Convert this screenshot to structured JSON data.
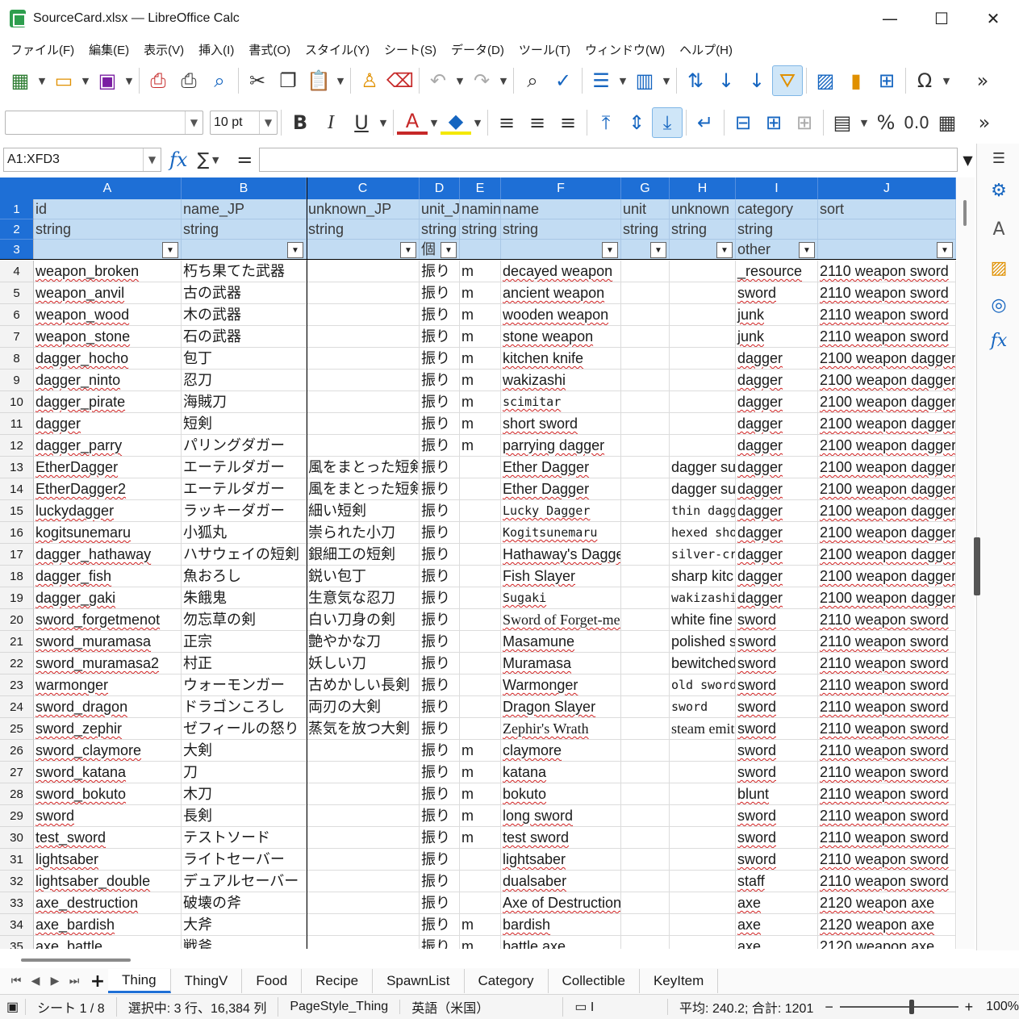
{
  "window": {
    "title": "SourceCard.xlsx — LibreOffice Calc",
    "minimize": "—",
    "maximize": "☐",
    "close": "✕"
  },
  "menu": [
    "ファイル(F)",
    "編集(E)",
    "表示(V)",
    "挿入(I)",
    "書式(O)",
    "スタイル(Y)",
    "シート(S)",
    "データ(D)",
    "ツール(T)",
    "ウィンドウ(W)",
    "ヘルプ(H)"
  ],
  "toolbar": {
    "font_name": "",
    "font_size": "10 pt",
    "bold": "B",
    "italic": "I",
    "underline": "U",
    "font_color": "A",
    "percent": "%",
    "decimal": "0.0",
    "more": "»"
  },
  "formula_bar": {
    "name_box": "A1:XFD3",
    "fx": "fx",
    "sum": "∑",
    "equals": "=",
    "content": ""
  },
  "columns": [
    "A",
    "B",
    "C",
    "D",
    "E",
    "F",
    "G",
    "H",
    "I",
    "J"
  ],
  "header_rows": [
    [
      "id",
      "name_JP",
      "unknown_JP",
      "unit_JP",
      "naming",
      "name",
      "unit",
      "unknown",
      "category",
      "sort"
    ],
    [
      "string",
      "string",
      "string",
      "string",
      "string",
      "string",
      "string",
      "string",
      "string",
      ""
    ],
    [
      "",
      "",
      "",
      "個",
      "",
      "",
      "",
      "",
      "other",
      ""
    ]
  ],
  "rows": [
    [
      "weapon_broken",
      "朽ち果てた武器",
      "",
      "振り",
      "m",
      "decayed weapon",
      "",
      "",
      "_resource",
      "2110 weapon sword"
    ],
    [
      "weapon_anvil",
      "古の武器",
      "",
      "振り",
      "m",
      "ancient weapon",
      "",
      "",
      "sword",
      "2110 weapon sword"
    ],
    [
      "weapon_wood",
      "木の武器",
      "",
      "振り",
      "m",
      "wooden weapon",
      "",
      "",
      "junk",
      "2110 weapon sword"
    ],
    [
      "weapon_stone",
      "石の武器",
      "",
      "振り",
      "m",
      "stone weapon",
      "",
      "",
      "junk",
      "2110 weapon sword"
    ],
    [
      "dagger_hocho",
      "包丁",
      "",
      "振り",
      "m",
      "kitchen knife",
      "",
      "",
      "dagger",
      "2100 weapon dagger"
    ],
    [
      "dagger_ninto",
      "忍刀",
      "",
      "振り",
      "m",
      "wakizashi",
      "",
      "",
      "dagger",
      "2100 weapon dagger"
    ],
    [
      "dagger_pirate",
      "海賊刀",
      "",
      "振り",
      "m",
      "scimitar",
      "",
      "",
      "dagger",
      "2100 weapon dagger"
    ],
    [
      "dagger",
      "短剣",
      "",
      "振り",
      "m",
      "short sword",
      "",
      "",
      "dagger",
      "2100 weapon dagger"
    ],
    [
      "dagger_parry",
      "パリングダガー",
      "",
      "振り",
      "m",
      "parrying dagger",
      "",
      "",
      "dagger",
      "2100 weapon dagger"
    ],
    [
      "EtherDagger",
      "エーテルダガー",
      "風をまとった短剣",
      "振り",
      "",
      "Ether Dagger",
      "",
      "dagger su",
      "dagger",
      "2100 weapon dagger"
    ],
    [
      "EtherDagger2",
      "エーテルダガー",
      "風をまとった短剣",
      "振り",
      "",
      "Ether Dagger",
      "",
      "dagger su",
      "dagger",
      "2100 weapon dagger"
    ],
    [
      "luckydagger",
      "ラッキーダガー",
      "細い短剣",
      "振り",
      "",
      "Lucky Dagger",
      "",
      "thin dagge",
      "dagger",
      "2100 weapon dagger"
    ],
    [
      "kogitsunemaru",
      "小狐丸",
      "崇られた小刀",
      "振り",
      "",
      "Kogitsunemaru",
      "",
      "hexed shor",
      "dagger",
      "2100 weapon dagger"
    ],
    [
      "dagger_hathaway",
      "ハサウェイの短剣",
      "銀細工の短剣",
      "振り",
      "",
      "Hathaway's Dagger",
      "",
      "silver-cra",
      "dagger",
      "2100 weapon dagger"
    ],
    [
      "dagger_fish",
      "魚おろし",
      "鋭い包丁",
      "振り",
      "",
      "Fish Slayer",
      "",
      "sharp kitc",
      "dagger",
      "2100 weapon dagger"
    ],
    [
      "dagger_gaki",
      "朱餓鬼",
      "生意気な忍刀",
      "振り",
      "",
      "Sugaki",
      "",
      "wakizashi",
      "dagger",
      "2100 weapon dagger"
    ],
    [
      "sword_forgetmenot",
      "勿忘草の剣",
      "白い刀身の剣",
      "振り",
      "",
      "Sword of Forget-me-not",
      "",
      "white fine",
      "sword",
      "2110 weapon sword"
    ],
    [
      "sword_muramasa",
      "正宗",
      "艶やかな刀",
      "振り",
      "",
      "Masamune",
      "",
      "polished s",
      "sword",
      "2110 weapon sword"
    ],
    [
      "sword_muramasa2",
      "村正",
      "妖しい刀",
      "振り",
      "",
      "Muramasa",
      "",
      "bewitched",
      "sword",
      "2110 weapon sword"
    ],
    [
      "warmonger",
      "ウォーモンガー",
      "古めかしい長剣",
      "振り",
      "",
      "Warmonger",
      "",
      "old sword",
      "sword",
      "2110 weapon sword"
    ],
    [
      "sword_dragon",
      "ドラゴンころし",
      "両刃の大剣",
      "振り",
      "",
      "Dragon Slayer",
      "",
      "sword",
      "sword",
      "2110 weapon sword"
    ],
    [
      "sword_zephir",
      "ゼフィールの怒り",
      "蒸気を放つ大剣",
      "振り",
      "",
      "Zephir's Wrath",
      "",
      "steam emit",
      "sword",
      "2110 weapon sword"
    ],
    [
      "sword_claymore",
      "大剣",
      "",
      "振り",
      "m",
      "claymore",
      "",
      "",
      "sword",
      "2110 weapon sword"
    ],
    [
      "sword_katana",
      "刀",
      "",
      "振り",
      "m",
      "katana",
      "",
      "",
      "sword",
      "2110 weapon sword"
    ],
    [
      "sword_bokuto",
      "木刀",
      "",
      "振り",
      "m",
      "bokuto",
      "",
      "",
      "blunt",
      "2110 weapon sword"
    ],
    [
      "sword",
      "長剣",
      "",
      "振り",
      "m",
      "long sword",
      "",
      "",
      "sword",
      "2110 weapon sword"
    ],
    [
      "test_sword",
      "テストソード",
      "",
      "振り",
      "m",
      "test sword",
      "",
      "",
      "sword",
      "2110 weapon sword"
    ],
    [
      "lightsaber",
      "ライトセーバー",
      "",
      "振り",
      "",
      "lightsaber",
      "",
      "",
      "sword",
      "2110 weapon sword"
    ],
    [
      "lightsaber_double",
      "デュアルセーバー",
      "",
      "振り",
      "",
      "dualsaber",
      "",
      "",
      "staff",
      "2110 weapon sword"
    ],
    [
      "axe_destruction",
      "破壊の斧",
      "",
      "振り",
      "",
      "Axe of Destruction",
      "",
      "",
      "axe",
      "2120 weapon axe"
    ],
    [
      "axe_bardish",
      "大斧",
      "",
      "振り",
      "m",
      "bardish",
      "",
      "",
      "axe",
      "2120 weapon axe"
    ],
    [
      "axe_battle",
      "戦斧",
      "",
      "振り",
      "m",
      "battle axe",
      "",
      "",
      "axe",
      "2120 weapon axe"
    ]
  ],
  "sheets": [
    "Thing",
    "ThingV",
    "Food",
    "Recipe",
    "SpawnList",
    "Category",
    "Collectible",
    "KeyItem"
  ],
  "active_sheet": "Thing",
  "status": {
    "sheet": "シート 1 / 8",
    "selection": "選択中: 3 行、16,384 列",
    "page_style": "PageStyle_Thing",
    "language": "英語（米国）",
    "summary": "平均: 240.2; 合計: 1201",
    "zoom": "100%"
  },
  "colors": {
    "header_blue": "#1e6fd6",
    "selection_fill": "#c2dcf3",
    "accent_blue": "#1565c0"
  }
}
